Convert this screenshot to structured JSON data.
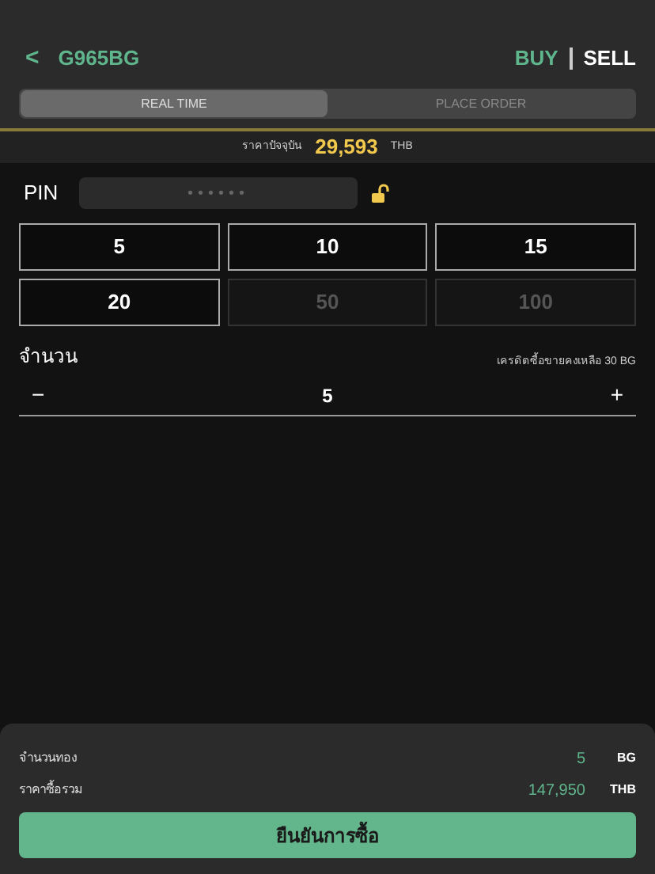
{
  "header": {
    "back": "<",
    "title": "G965BG",
    "modes": [
      {
        "label": "BUY",
        "selected": true
      },
      {
        "label": "SELL",
        "selected": false
      }
    ]
  },
  "tabs": [
    {
      "label": "REAL TIME",
      "selected": true
    },
    {
      "label": "PLACE ORDER",
      "selected": false
    }
  ],
  "price": {
    "label": "ราคาปัจจุบัน",
    "value": "29,593",
    "unit": "THB"
  },
  "pin": {
    "label": "PIN",
    "placeholder": "••••••",
    "locked": false
  },
  "amounts": [
    {
      "label": "5",
      "disabled": false
    },
    {
      "label": "10",
      "disabled": false
    },
    {
      "label": "15",
      "disabled": false
    },
    {
      "label": "20",
      "disabled": false
    },
    {
      "label": "50",
      "disabled": true
    },
    {
      "label": "100",
      "disabled": true
    }
  ],
  "quantity": {
    "label": "จำนวน",
    "credit": "เครดิตซื้อขายคงเหลือ 30 BG",
    "minus": "−",
    "value": "5",
    "plus": "+"
  },
  "summary": [
    {
      "label": "จำนวนทอง",
      "value": "5",
      "unit": "BG"
    },
    {
      "label": "ราคาซื้อรวม",
      "value": "147,950",
      "unit": "THB"
    }
  ],
  "confirm": "ยืนยันการซื้อ"
}
